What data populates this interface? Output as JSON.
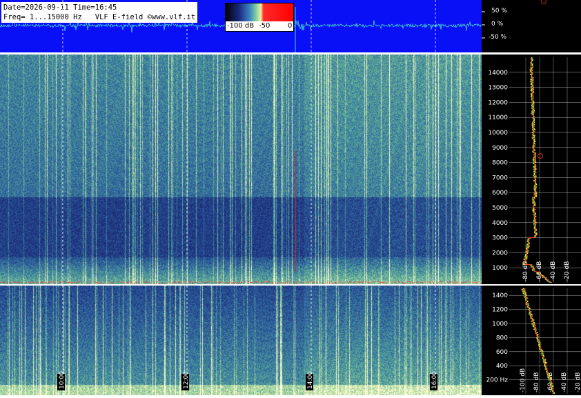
{
  "header": {
    "date_line": "Date=2026-09-11 Time=16:45",
    "freq_line": "Freq= 1...15000 Hz   VLF E-field ©www.vlf.it"
  },
  "colorbar": {
    "labels": [
      "-100 dB",
      "-50",
      "0"
    ],
    "colors": [
      "#000000",
      "#1a2a80",
      "#3a80c0",
      "#80d0a0",
      "#f0f0a0",
      "#ff2a2a",
      "#ff0000"
    ]
  },
  "waveform_axis": {
    "labels": [
      "50 %",
      "0 %",
      "-50 %"
    ],
    "values": [
      50,
      0,
      -50
    ]
  },
  "chart_data": [
    {
      "type": "heatmap",
      "name_hint": "high-band spectrogram",
      "x_ticks": [
        "10:00",
        "12:00",
        "14:00",
        "16:00"
      ],
      "freq_ticks": [
        1000,
        2000,
        3000,
        4000,
        5000,
        6000,
        7000,
        8000,
        9000,
        10000,
        11000,
        12000,
        13000,
        14000
      ],
      "ylim": [
        0,
        15000
      ],
      "level_ticks": [
        "-80 dB",
        "-60 dB",
        "-40 dB",
        "-20 dB"
      ]
    },
    {
      "type": "heatmap",
      "name_hint": "low-band spectrogram",
      "x_ticks": [
        "10:00",
        "12:00",
        "14:00",
        "16:00"
      ],
      "freq_ticks": [
        "200 Hz",
        "400",
        "600",
        "800",
        "1000",
        "1200",
        "1400"
      ],
      "ylim": [
        0,
        1500
      ],
      "level_ticks": [
        "-100 dB",
        "-80 dB",
        "-60 dB",
        "-40 dB",
        "-20 dB"
      ]
    }
  ],
  "colors": {
    "waveform_bg": "#0a10f5",
    "waveform_trace": "#3fd8d0",
    "spectrum_yellow": "#ffff40",
    "spectrum_red": "#ff2020",
    "spectrum_green": "#40ff40"
  }
}
